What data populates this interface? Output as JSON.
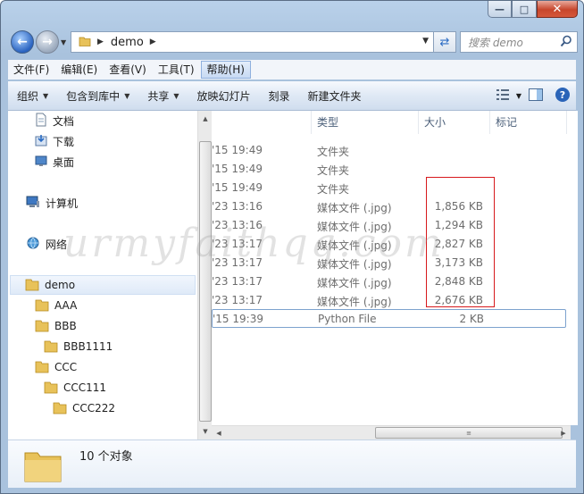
{
  "window": {
    "address": {
      "crumb": "demo"
    },
    "search": {
      "placeholder": "搜索 demo"
    }
  },
  "menu": [
    "文件(F)",
    "编辑(E)",
    "查看(V)",
    "工具(T)",
    "帮助(H)"
  ],
  "toolbar": {
    "organize": "组织",
    "include_library": "包含到库中",
    "share": "共享",
    "slideshow": "放映幻灯片",
    "burn": "刻录",
    "new_folder": "新建文件夹"
  },
  "nav_tree": {
    "documents": "文档",
    "downloads": "下载",
    "desktop": "桌面",
    "computer": "计算机",
    "network": "网络",
    "demo": "demo",
    "aaa": "AAA",
    "bbb": "BBB",
    "bbb1111": "BBB1111",
    "ccc": "CCC",
    "ccc111": "CCC111",
    "ccc222": "CCC222"
  },
  "columns": {
    "type": "类型",
    "size": "大小",
    "tags": "标记"
  },
  "files": [
    {
      "date": "'15 19:49",
      "type": "文件夹",
      "size": ""
    },
    {
      "date": "'15 19:49",
      "type": "文件夹",
      "size": ""
    },
    {
      "date": "'15 19:49",
      "type": "文件夹",
      "size": ""
    },
    {
      "date": "'23 13:16",
      "type": "媒体文件 (.jpg)",
      "size": "1,856 KB"
    },
    {
      "date": "'23 13:16",
      "type": "媒体文件 (.jpg)",
      "size": "1,294 KB"
    },
    {
      "date": "'23 13:17",
      "type": "媒体文件 (.jpg)",
      "size": "2,827 KB"
    },
    {
      "date": "'23 13:17",
      "type": "媒体文件 (.jpg)",
      "size": "3,173 KB"
    },
    {
      "date": "'23 13:17",
      "type": "媒体文件 (.jpg)",
      "size": "2,848 KB"
    },
    {
      "date": "'23 13:17",
      "type": "媒体文件 (.jpg)",
      "size": "2,676 KB"
    },
    {
      "date": "'15 19:39",
      "type": "Python File",
      "size": "2 KB"
    }
  ],
  "details": {
    "count": "10 个对象"
  },
  "watermark": "urmyfaithqq.com",
  "colors": {
    "highlight_box": "#d7191c",
    "selection": "#dfeaf8",
    "accent": "#2b6cc4"
  }
}
